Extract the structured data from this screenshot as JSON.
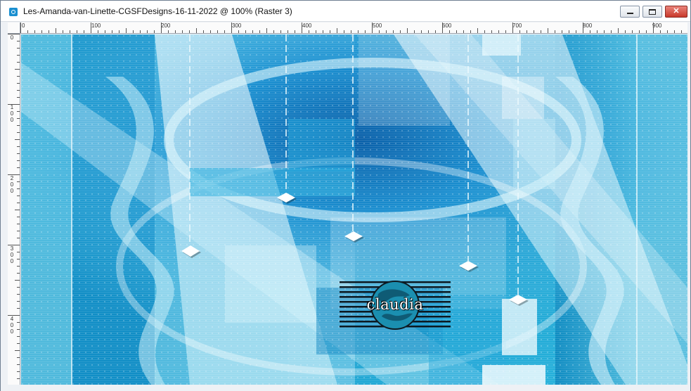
{
  "window": {
    "title": "Les-Amanda-van-Linette-CGSFDesigns-16-11-2022 @ 100% (Raster 3)",
    "icon": "psp-document-icon",
    "controls": {
      "minimize": "minimize-icon",
      "maximize": "maximize-icon",
      "close": "close-icon",
      "close_glyph": "✕"
    }
  },
  "ruler_top": {
    "labels": [
      "0",
      "100",
      "200",
      "300",
      "400",
      "500",
      "600",
      "700",
      "800",
      "900"
    ]
  },
  "ruler_left": {
    "labels": [
      "0",
      "100",
      "200",
      "300",
      "400"
    ]
  },
  "canvas": {
    "watermark_text": "claudia",
    "watermark_colors": {
      "stripes": "#0d1a22",
      "globe": "#1b8fb0"
    },
    "palette": {
      "base": "#1aa0cf",
      "deep": "#0a7fb8",
      "light": "#bfeaf6",
      "pale": "#e6f7fc",
      "cyan": "#2fc4e6"
    }
  }
}
